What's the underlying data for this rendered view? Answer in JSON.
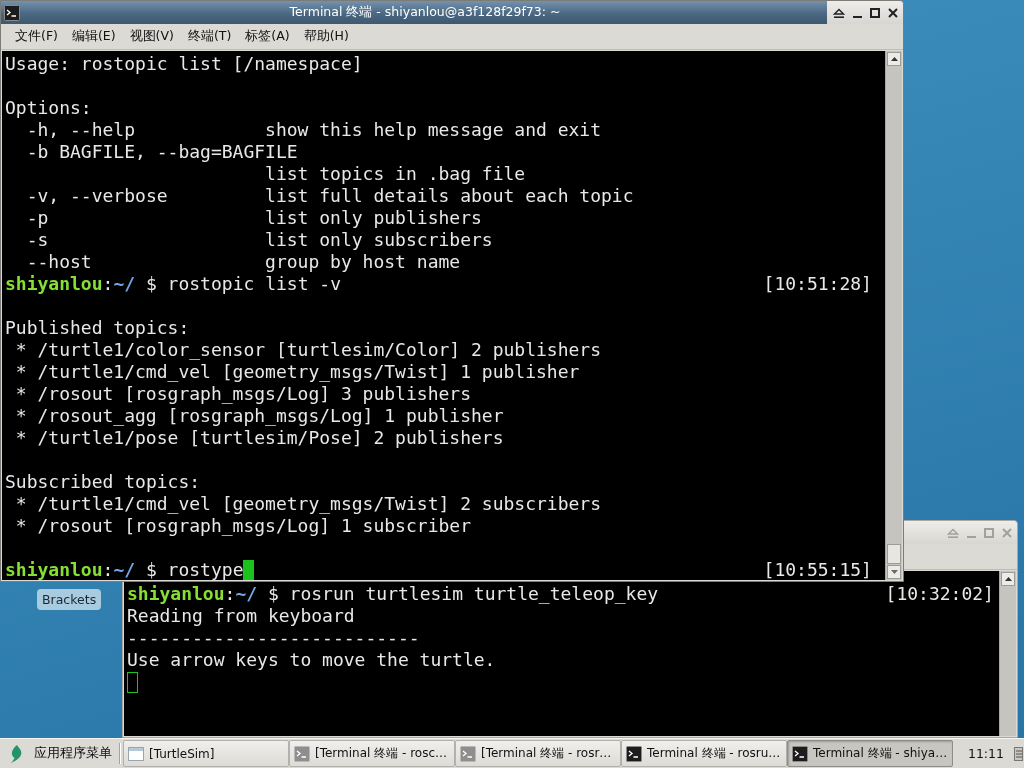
{
  "windows": [
    {
      "title": "Terminal 终端 - shiyanlou@a3f128f29f73: ~",
      "active": true,
      "menu": [
        {
          "label": "文件(F)"
        },
        {
          "label": "编辑(E)"
        },
        {
          "label": "视图(V)"
        },
        {
          "label": "终端(T)"
        },
        {
          "label": "标签(A)"
        },
        {
          "label": "帮助(H)"
        }
      ],
      "lines": [
        {
          "kind": "text",
          "text": "Usage: rostopic list [/namespace]"
        },
        {
          "kind": "blank"
        },
        {
          "kind": "text",
          "text": "Options:"
        },
        {
          "kind": "option",
          "flag": "-h, --help",
          "description": "show this help message and exit"
        },
        {
          "kind": "option",
          "flag": "-b BAGFILE, --bag=BAGFILE"
        },
        {
          "kind": "option",
          "description": "list topics in .bag file"
        },
        {
          "kind": "option",
          "flag": "-v, --verbose",
          "description": "list full details about each topic"
        },
        {
          "kind": "option",
          "flag": "-p",
          "description": "list only publishers"
        },
        {
          "kind": "option",
          "flag": "-s",
          "description": "list only subscribers"
        },
        {
          "kind": "option",
          "flag": "--host",
          "description": "group by host name"
        },
        {
          "kind": "prompt",
          "user": "shiyanlou",
          "separator": ":",
          "path": "~/",
          "symbol": "$",
          "command": "rostopic list -v",
          "time": "[10:51:28]"
        },
        {
          "kind": "blank"
        },
        {
          "kind": "text",
          "text": "Published topics:"
        },
        {
          "kind": "item",
          "text": "* /turtle1/color_sensor [turtlesim/Color] 2 publishers"
        },
        {
          "kind": "item",
          "text": "* /turtle1/cmd_vel [geometry_msgs/Twist] 1 publisher"
        },
        {
          "kind": "item",
          "text": "* /rosout [rosgraph_msgs/Log] 3 publishers"
        },
        {
          "kind": "item",
          "text": "* /rosout_agg [rosgraph_msgs/Log] 1 publisher"
        },
        {
          "kind": "item",
          "text": "* /turtle1/pose [turtlesim/Pose] 2 publishers"
        },
        {
          "kind": "blank"
        },
        {
          "kind": "text",
          "text": "Subscribed topics:"
        },
        {
          "kind": "item",
          "text": "* /turtle1/cmd_vel [geometry_msgs/Twist] 2 subscribers"
        },
        {
          "kind": "item",
          "text": "* /rosout [rosgraph_msgs/Log] 1 subscriber"
        },
        {
          "kind": "blank"
        },
        {
          "kind": "prompt",
          "user": "shiyanlou",
          "separator": ":",
          "path": "~/",
          "symbol": "$",
          "command": "rostype",
          "cursor": {
            "focused": true
          },
          "time": "[10:55:15]"
        }
      ]
    },
    {
      "active": false,
      "lines": [
        {
          "kind": "prompt",
          "user": "shiyanlou",
          "separator": ":",
          "path": "~/",
          "symbol": "$",
          "command": "rosrun turtlesim turtle_teleop_key",
          "time": "[10:32:02]"
        },
        {
          "kind": "text",
          "text": "Reading from keyboard"
        },
        {
          "kind": "text",
          "text": "---------------------------"
        },
        {
          "kind": "text",
          "text": "Use arrow keys to move the turtle."
        },
        {
          "kind": "cursor",
          "cursor": {
            "focused": false
          }
        }
      ]
    }
  ],
  "desktop_icons": [
    {
      "label": "Brackets"
    }
  ],
  "taskbar": {
    "app_menu": {
      "label": "应用程序菜单"
    },
    "tasks": [
      {
        "kind": "window",
        "label": "[TurtleSim]",
        "minimized": true,
        "selected": false
      },
      {
        "kind": "terminal",
        "label": "[Terminal 终端 - rosc…",
        "minimized": true,
        "selected": false
      },
      {
        "kind": "terminal",
        "label": "[Terminal 终端 - rosr…",
        "minimized": true,
        "selected": false
      },
      {
        "kind": "terminal",
        "label": "Terminal 终端 - rosru…",
        "minimized": false,
        "selected": false
      },
      {
        "kind": "terminal",
        "label": "Terminal 终端 - shiya…",
        "minimized": false,
        "selected": true
      }
    ],
    "clock": "11:11"
  }
}
